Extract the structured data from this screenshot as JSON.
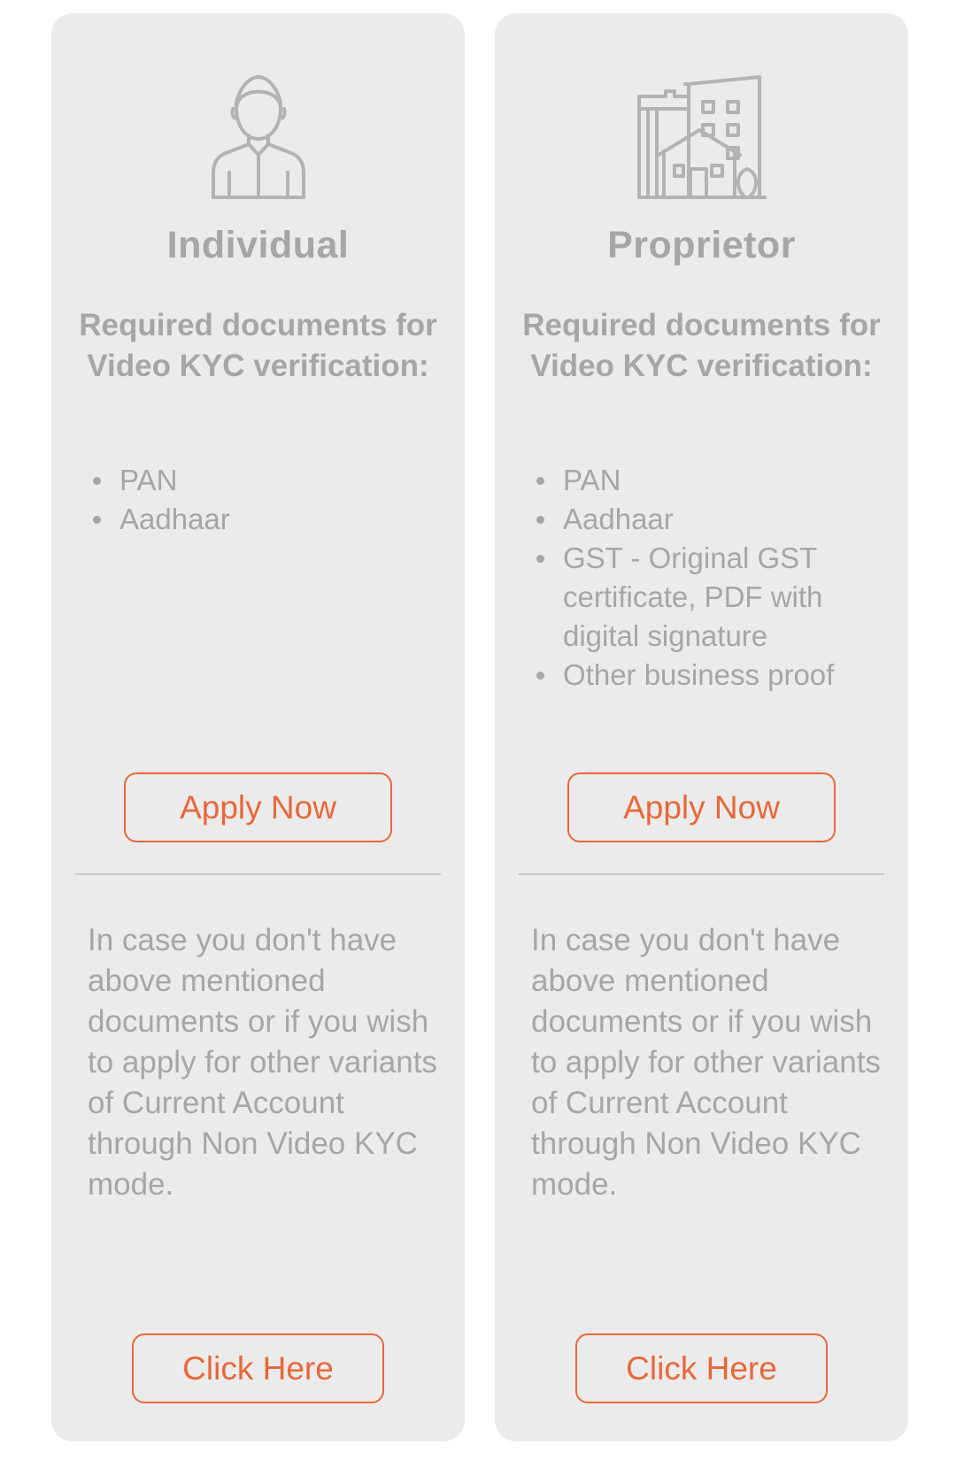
{
  "colors": {
    "card_background": "#ebebeb",
    "text_gray": "#a6a6a6",
    "accent_orange": "#e8683a",
    "divider": "#c9c9c9"
  },
  "cards": [
    {
      "icon": "person-icon",
      "title": "Individual",
      "docs_heading": "Required documents for Video KYC verification:",
      "docs": [
        "PAN",
        "Aadhaar"
      ],
      "apply_label": "Apply Now",
      "note": "In case you don't have above mentioned documents or if you wish to apply for other variants of Current Account through Non Video KYC mode.",
      "click_label": "Click Here"
    },
    {
      "icon": "building-icon",
      "title": "Proprietor",
      "docs_heading": "Required documents for Video KYC verification:",
      "docs": [
        "PAN",
        "Aadhaar",
        "GST - Original GST certificate, PDF with digital signature",
        "Other business proof"
      ],
      "apply_label": "Apply Now",
      "note": "In case you don't have above mentioned documents or if you wish to apply for other variants of Current Account through Non Video KYC mode.",
      "click_label": "Click Here"
    }
  ]
}
